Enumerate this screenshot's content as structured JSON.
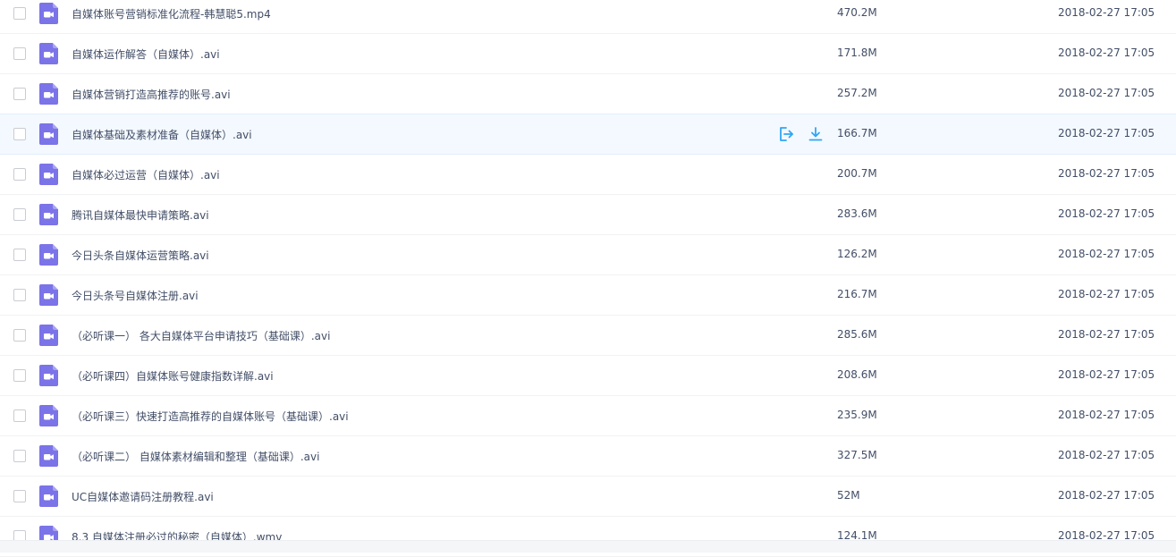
{
  "colors": {
    "video_icon": "#7b73e8",
    "action_icon": "#2ea6f5",
    "hover_row": "#f4f9ff"
  },
  "row_actions": {
    "share_icon": "share-out-icon",
    "download_icon": "download-icon"
  },
  "files": [
    {
      "name": "自媒体账号营销标准化流程-韩慧聪5.mp4",
      "size": "470.2M",
      "time": "2018-02-27 17:05",
      "icon": "video-file-icon"
    },
    {
      "name": "自媒体运作解答（自媒体）.avi",
      "size": "171.8M",
      "time": "2018-02-27 17:05",
      "icon": "video-file-icon"
    },
    {
      "name": "自媒体营销打造高推荐的账号.avi",
      "size": "257.2M",
      "time": "2018-02-27 17:05",
      "icon": "video-file-icon"
    },
    {
      "name": "自媒体基础及素材准备（自媒体）.avi",
      "size": "166.7M",
      "time": "2018-02-27 17:05",
      "icon": "video-file-icon",
      "hovered": true
    },
    {
      "name": "自媒体必过运营（自媒体）.avi",
      "size": "200.7M",
      "time": "2018-02-27 17:05",
      "icon": "video-file-icon"
    },
    {
      "name": "腾讯自媒体最快申请策略.avi",
      "size": "283.6M",
      "time": "2018-02-27 17:05",
      "icon": "video-file-icon"
    },
    {
      "name": "今日头条自媒体运营策略.avi",
      "size": "126.2M",
      "time": "2018-02-27 17:05",
      "icon": "video-file-icon"
    },
    {
      "name": "今日头条号自媒体注册.avi",
      "size": "216.7M",
      "time": "2018-02-27 17:05",
      "icon": "video-file-icon"
    },
    {
      "name": "（必听课一） 各大自媒体平台申请技巧（基础课）.avi",
      "size": "285.6M",
      "time": "2018-02-27 17:05",
      "icon": "video-file-icon"
    },
    {
      "name": "（必听课四）自媒体账号健康指数详解.avi",
      "size": "208.6M",
      "time": "2018-02-27 17:05",
      "icon": "video-file-icon"
    },
    {
      "name": "（必听课三）快速打造高推荐的自媒体账号（基础课）.avi",
      "size": "235.9M",
      "time": "2018-02-27 17:05",
      "icon": "video-file-icon"
    },
    {
      "name": "（必听课二） 自媒体素材编辑和整理（基础课）.avi",
      "size": "327.5M",
      "time": "2018-02-27 17:05",
      "icon": "video-file-icon"
    },
    {
      "name": "UC自媒体邀请码注册教程.avi",
      "size": "52M",
      "time": "2018-02-27 17:05",
      "icon": "video-file-icon"
    },
    {
      "name": "8.3 自媒体注册必过的秘密（自媒体）.wmv",
      "size": "124.1M",
      "time": "2018-02-27 17:05",
      "icon": "video-file-icon"
    }
  ]
}
